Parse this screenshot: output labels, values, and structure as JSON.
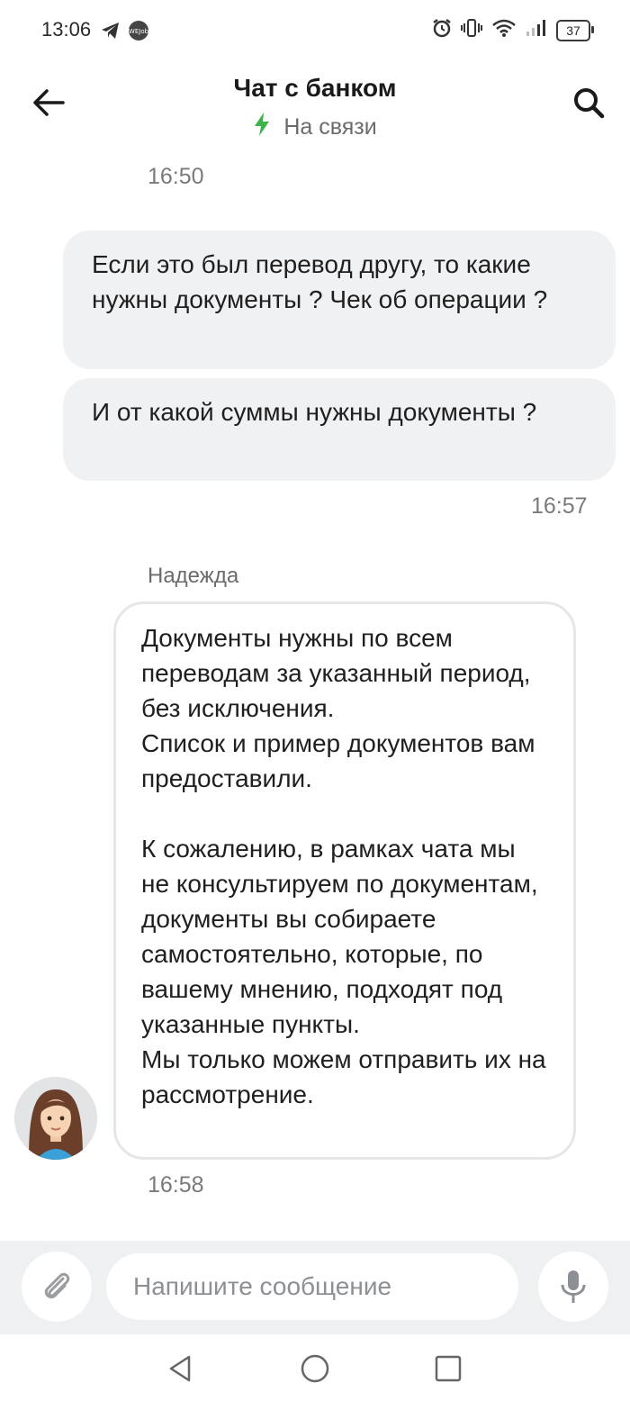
{
  "status_bar": {
    "time": "13:06",
    "battery": "37",
    "icons": [
      "telegram-icon",
      "notification-badge-icon",
      "alarm-icon",
      "vibrate-icon",
      "wifi-icon",
      "signal-icon",
      "battery-icon"
    ],
    "badge_text": "WEJob"
  },
  "header": {
    "title": "Чат с банком",
    "status": "На связи",
    "status_color": "#3bb54a"
  },
  "messages": [
    {
      "type": "time",
      "text": "16:50"
    },
    {
      "type": "outgoing",
      "text": "Если это был перевод другу, то какие нужны документы ? Чек об операции ?"
    },
    {
      "type": "outgoing",
      "text": "И от какой суммы нужны документы ?"
    },
    {
      "type": "time",
      "text": "16:57"
    },
    {
      "type": "incoming",
      "sender": "Надежда",
      "text": "Документы нужны по всем переводам за указанный период, без исключения.\nСписок и пример документов вам предоставили.\n\nК сожалению, в рамках чата мы не консультируем по документам, документы вы собираете самостоятельно, которые, по вашему мнению, подходят под указанные пункты.\nМы только можем отправить их на рассмотрение."
    },
    {
      "type": "time",
      "text": "16:58"
    }
  ],
  "composer": {
    "placeholder": "Напишите сообщение",
    "value": ""
  },
  "nav": {
    "buttons": [
      "back-triangle-icon",
      "home-circle-icon",
      "recents-square-icon"
    ]
  }
}
